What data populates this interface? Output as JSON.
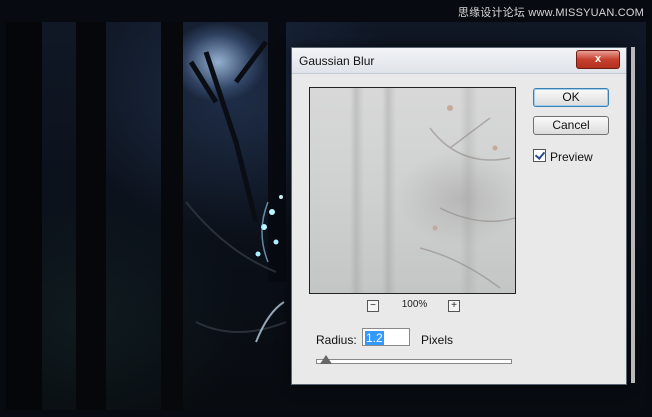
{
  "watermark": "思缘设计论坛 www.MISSYUAN.COM",
  "dialog": {
    "title": "Gaussian Blur",
    "close_label": "x",
    "ok_label": "OK",
    "cancel_label": "Cancel",
    "preview_label": "Preview",
    "preview_checked": true,
    "zoom_minus": "−",
    "zoom_plus": "+",
    "zoom_level": "100%",
    "radius_label": "Radius:",
    "radius_value": "1.2",
    "radius_unit": "Pixels",
    "slider_value": 1.2
  }
}
